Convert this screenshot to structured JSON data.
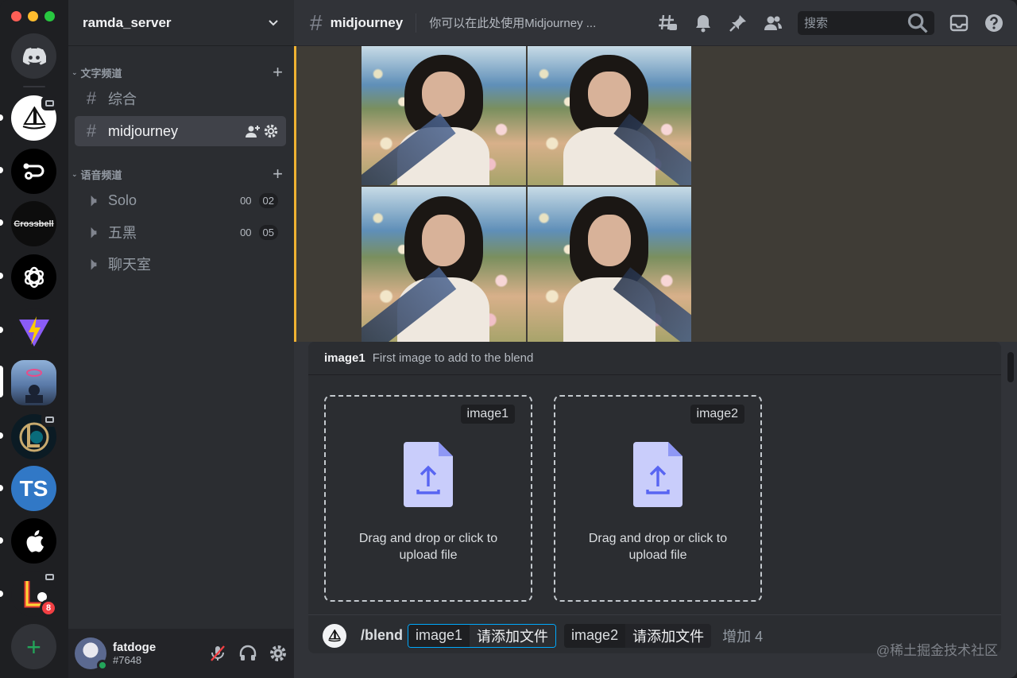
{
  "server": {
    "name": "ramda_server"
  },
  "rail": {
    "servers": [
      {
        "name": "Discord Home"
      },
      {
        "name": "Midjourney"
      },
      {
        "name": "Route"
      },
      {
        "name": "Crossbell",
        "text": "Crossbell"
      },
      {
        "name": "OpenAI"
      },
      {
        "name": "Vite"
      },
      {
        "name": "Photo server"
      },
      {
        "name": "League"
      },
      {
        "name": "TypeScript",
        "text": "TS"
      },
      {
        "name": "Apple"
      },
      {
        "name": "League alt",
        "badge": "8"
      }
    ],
    "colors": {
      "ts": "#3178c6",
      "add": "#23a55a",
      "badge": "#f23f43"
    }
  },
  "sidebar": {
    "text_category": "文字频道",
    "voice_category": "语音频道",
    "text_channels": [
      {
        "name": "综合"
      },
      {
        "name": "midjourney"
      }
    ],
    "voice_channels": [
      {
        "name": "Solo",
        "count_a": "00",
        "count_b": "02"
      },
      {
        "name": "五黑",
        "count_a": "00",
        "count_b": "05"
      },
      {
        "name": "聊天室"
      }
    ]
  },
  "user": {
    "name": "fatdoge",
    "tag": "#7648"
  },
  "topbar": {
    "channel": "midjourney",
    "topic": "你可以在此处使用Midjourney ...",
    "search_placeholder": "搜索"
  },
  "command": {
    "option_name": "image1",
    "option_description": "First image to add to the blend",
    "uploads": [
      {
        "tag": "image1",
        "caption_line1": "Drag and drop or click to",
        "caption_line2": "upload file"
      },
      {
        "tag": "image2",
        "caption_line1": "Drag and drop or click to",
        "caption_line2": "upload file"
      }
    ],
    "slash": "/blend",
    "chip1_key": "image1",
    "chip1_value": "请添加文件",
    "chip2_key": "image2",
    "chip2_value": "请添加文件",
    "more": "增加 4"
  },
  "watermark": "@稀土掘金技术社区",
  "colors": {
    "accent": "#5865f2",
    "mention": "#f0b232",
    "focus": "#00a8fc"
  }
}
